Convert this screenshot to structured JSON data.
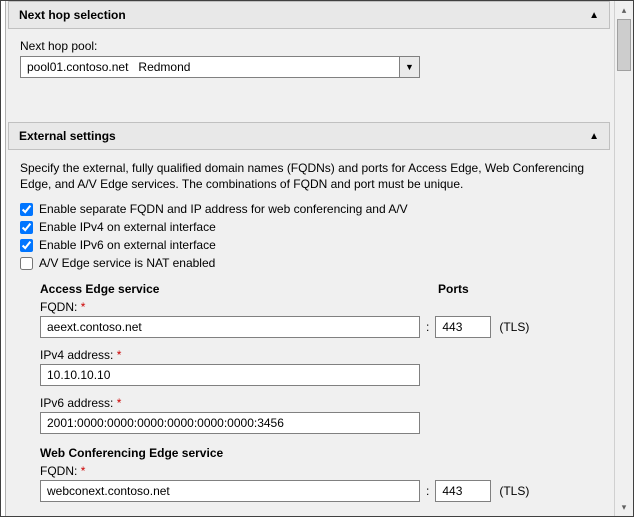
{
  "sections": {
    "next_hop": {
      "title": "Next hop selection",
      "pool_label": "Next hop pool:",
      "pool_value": "pool01.contoso.net   Redmond"
    },
    "external": {
      "title": "External settings",
      "description": "Specify the external, fully qualified domain names (FQDNs) and ports for Access Edge, Web Conferencing Edge, and A/V Edge services. The combinations of FQDN and port must be unique.",
      "checkboxes": {
        "separate_fqdn": {
          "label": "Enable separate FQDN and IP address for web conferencing and A/V",
          "checked": true
        },
        "ipv4_ext": {
          "label": "Enable IPv4 on external interface",
          "checked": true
        },
        "ipv6_ext": {
          "label": "Enable IPv6 on external interface",
          "checked": true
        },
        "nat_enabled": {
          "label": "A/V Edge service is NAT enabled",
          "checked": false
        }
      },
      "ports_header": "Ports",
      "access_edge": {
        "title": "Access Edge service",
        "fqdn_label": "FQDN:",
        "fqdn_value": "aeext.contoso.net",
        "port_value": "443",
        "protocol": "(TLS)",
        "ipv4_label": "IPv4 address:",
        "ipv4_value": "10.10.10.10",
        "ipv6_label": "IPv6 address:",
        "ipv6_value": "2001:0000:0000:0000:0000:0000:0000:3456"
      },
      "webconf_edge": {
        "title": "Web Conferencing Edge service",
        "fqdn_label": "FQDN:",
        "fqdn_value": "webconext.contoso.net",
        "port_value": "443",
        "protocol": "(TLS)"
      }
    }
  },
  "required_marker": "*"
}
